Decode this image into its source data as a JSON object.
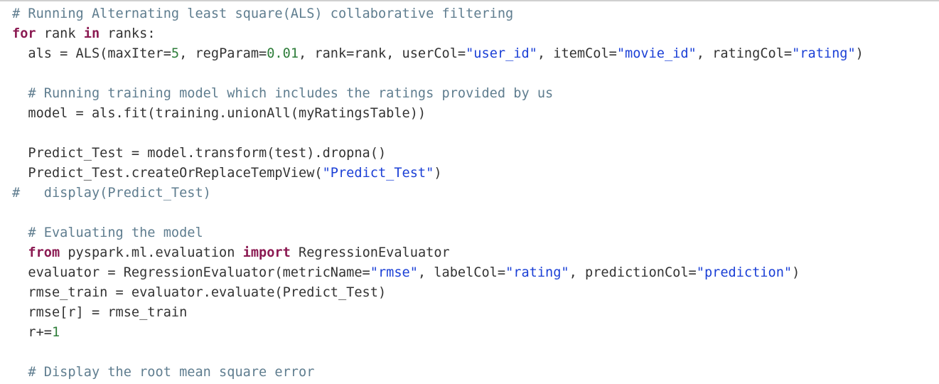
{
  "code_cell": {
    "lines": [
      [
        {
          "t": "# Running Alternating least square(ALS) collaborative filtering",
          "k": "comment"
        }
      ],
      [
        {
          "t": "for",
          "k": "keyword"
        },
        {
          "t": " rank ",
          "k": "plain"
        },
        {
          "t": "in",
          "k": "keyword"
        },
        {
          "t": " ranks:",
          "k": "plain"
        }
      ],
      [
        {
          "t": "  als = ALS(maxIter=",
          "k": "plain"
        },
        {
          "t": "5",
          "k": "number"
        },
        {
          "t": ", regParam=",
          "k": "plain"
        },
        {
          "t": "0.01",
          "k": "number"
        },
        {
          "t": ", rank=rank, userCol=",
          "k": "plain"
        },
        {
          "t": "\"user_id\"",
          "k": "string"
        },
        {
          "t": ", itemCol=",
          "k": "plain"
        },
        {
          "t": "\"movie_id\"",
          "k": "string"
        },
        {
          "t": ", ratingCol=",
          "k": "plain"
        },
        {
          "t": "\"rating\"",
          "k": "string"
        },
        {
          "t": ")",
          "k": "plain"
        }
      ],
      [],
      [
        {
          "t": "  ",
          "k": "plain"
        },
        {
          "t": "# Running training model which includes the ratings provided by us",
          "k": "comment"
        }
      ],
      [
        {
          "t": "  model = als.fit(training.unionAll(myRatingsTable))",
          "k": "plain"
        }
      ],
      [],
      [
        {
          "t": "  Predict_Test = model.transform(test).dropna()",
          "k": "plain"
        }
      ],
      [
        {
          "t": "  Predict_Test.createOrReplaceTempView(",
          "k": "plain"
        },
        {
          "t": "\"Predict_Test\"",
          "k": "string"
        },
        {
          "t": ")",
          "k": "plain"
        }
      ],
      [
        {
          "t": "#   display(Predict_Test)",
          "k": "comment"
        }
      ],
      [],
      [
        {
          "t": "  ",
          "k": "plain"
        },
        {
          "t": "# Evaluating the model",
          "k": "comment"
        }
      ],
      [
        {
          "t": "  ",
          "k": "plain"
        },
        {
          "t": "from",
          "k": "keyword"
        },
        {
          "t": " pyspark.ml.evaluation ",
          "k": "plain"
        },
        {
          "t": "import",
          "k": "keyword"
        },
        {
          "t": " RegressionEvaluator",
          "k": "plain"
        }
      ],
      [
        {
          "t": "  evaluator = RegressionEvaluator(metricName=",
          "k": "plain"
        },
        {
          "t": "\"rmse\"",
          "k": "string"
        },
        {
          "t": ", labelCol=",
          "k": "plain"
        },
        {
          "t": "\"rating\"",
          "k": "string"
        },
        {
          "t": ", predictionCol=",
          "k": "plain"
        },
        {
          "t": "\"prediction\"",
          "k": "string"
        },
        {
          "t": ")",
          "k": "plain"
        }
      ],
      [
        {
          "t": "  rmse_train = evaluator.evaluate(Predict_Test)",
          "k": "plain"
        }
      ],
      [
        {
          "t": "  rmse[r] = rmse_train",
          "k": "plain"
        }
      ],
      [
        {
          "t": "  r+=",
          "k": "plain"
        },
        {
          "t": "1",
          "k": "number"
        }
      ],
      [],
      [
        {
          "t": "  ",
          "k": "plain"
        },
        {
          "t": "# Display the root mean square error",
          "k": "comment"
        }
      ]
    ]
  }
}
